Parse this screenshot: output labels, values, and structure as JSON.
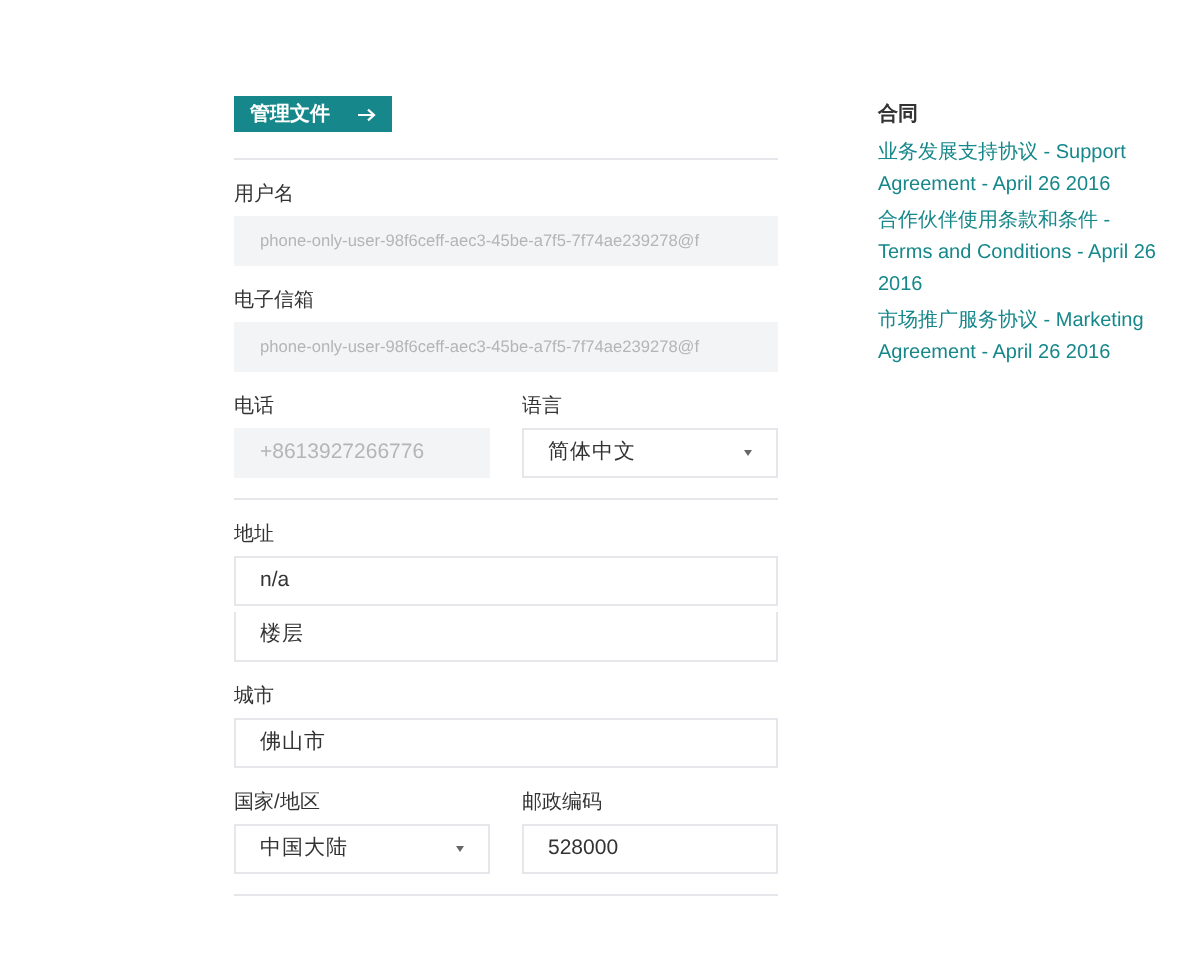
{
  "manage_button": {
    "label": "管理文件"
  },
  "sections": [
    {
      "rows": [
        [
          {
            "label": "用户名",
            "kind": "text",
            "disabled": true,
            "values": [
              "phone-only-user-98f6ceff-aec3-45be-a7f5-7f74ae239278@f"
            ]
          }
        ],
        [
          {
            "label": "电子信箱",
            "kind": "text",
            "disabled": true,
            "values": [
              "phone-only-user-98f6ceff-aec3-45be-a7f5-7f74ae239278@f"
            ]
          }
        ],
        [
          {
            "label": "电话",
            "kind": "text",
            "disabled": true,
            "values": [
              "+8613927266776"
            ]
          },
          {
            "label": "语言",
            "kind": "select",
            "disabled": false,
            "values": [
              "简体中文"
            ]
          }
        ]
      ]
    },
    {
      "rows": [
        [
          {
            "label": "地址",
            "kind": "text",
            "disabled": false,
            "values": [
              "n/a",
              "楼层"
            ]
          }
        ],
        [
          {
            "label": "城市",
            "kind": "text",
            "disabled": false,
            "values": [
              "佛山市"
            ]
          }
        ],
        [
          {
            "label": "国家/地区",
            "kind": "select",
            "disabled": false,
            "values": [
              "中国大陆"
            ]
          },
          {
            "label": "邮政编码",
            "kind": "text",
            "disabled": false,
            "values": [
              "528000"
            ]
          }
        ]
      ]
    }
  ],
  "contracts": {
    "title": "合同",
    "items": [
      {
        "text": "业务发展支持协议 - Support Agreement - April 26 2016"
      },
      {
        "text": "合作伙伴使用条款和条件 - Terms and Conditions - April 26 2016"
      },
      {
        "text": "市场推广服务协议 - Marketing Agreement - April 26 2016"
      }
    ]
  }
}
